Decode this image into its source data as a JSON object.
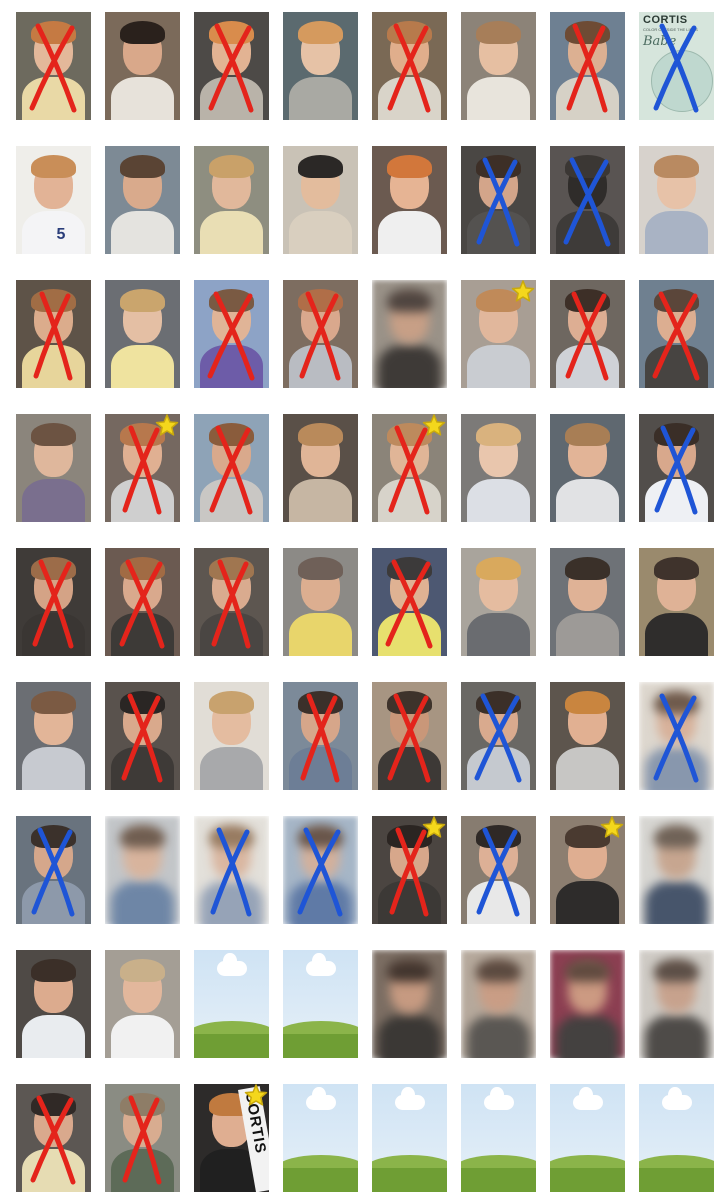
{
  "colors": {
    "x_red": "#e4241b",
    "x_blue": "#1f55d6",
    "star_yellow": "#f4d71c",
    "star_outline": "#c9a90d",
    "sky": "#d8e8f6",
    "grass": "#7ea843"
  },
  "marks_legend": [
    "red-x",
    "blue-x",
    "star",
    "none"
  ],
  "texts": {
    "cover_title": "CORTIS",
    "cover_sub": "COLOR OUTSIDE THE LINES",
    "cover_script": "Babe",
    "shirt_number": "5",
    "banner_text": "CORTIS"
  },
  "rows": [
    [
      {
        "kind": "photo",
        "mark": "red-x",
        "bg": "#6d6a5e",
        "skin": "#e3b89a",
        "hair": "#c57a43",
        "shirt": "#e9d9a6"
      },
      {
        "kind": "photo",
        "mark": "none",
        "bg": "#7b6a5a",
        "skin": "#d9a88a",
        "hair": "#2a211c",
        "shirt": "#e7e2da"
      },
      {
        "kind": "photo",
        "mark": "red-x",
        "bg": "#4d4a47",
        "skin": "#e2b393",
        "hair": "#d98c4c",
        "shirt": "#b9b3a9"
      },
      {
        "kind": "photo",
        "mark": "none",
        "bg": "#5b6a6f",
        "skin": "#e6c2a6",
        "hair": "#d59a5e",
        "shirt": "#a9a9a3"
      },
      {
        "kind": "photo",
        "mark": "red-x",
        "bg": "#7a6955",
        "skin": "#e0ae8c",
        "hair": "#b77a4c",
        "shirt": "#d9d4c9"
      },
      {
        "kind": "photo",
        "mark": "none",
        "bg": "#8c8378",
        "skin": "#e6bfa2",
        "hair": "#a77e59",
        "shirt": "#e8e4dc"
      },
      {
        "kind": "photo",
        "mark": "red-x",
        "bg": "#6e8092",
        "skin": "#dcb092",
        "hair": "#6e4b34",
        "shirt": "#d6d1c6"
      },
      {
        "kind": "cover",
        "mark": "blue-x",
        "bg": "#d6e5dc"
      }
    ],
    [
      {
        "kind": "shirt5",
        "mark": "none",
        "bg": "#efeeea",
        "skin": "#e2b396",
        "hair": "#c98e58",
        "shirt": "#f4f4f6"
      },
      {
        "kind": "photo",
        "mark": "none",
        "bg": "#7d8a95",
        "skin": "#d9aa8c",
        "hair": "#5a4434",
        "shirt": "#e4e3df"
      },
      {
        "kind": "photo",
        "mark": "none",
        "bg": "#8e8e80",
        "skin": "#e1b89b",
        "hair": "#c9a169",
        "shirt": "#e9deb4"
      },
      {
        "kind": "photo",
        "mark": "none",
        "bg": "#c9c2b6",
        "skin": "#e3bc9d",
        "hair": "#2b2826",
        "shirt": "#d9cfbf"
      },
      {
        "kind": "photo",
        "mark": "none",
        "bg": "#6b5a50",
        "skin": "#e6b494",
        "hair": "#d2773b",
        "shirt": "#efefef"
      },
      {
        "kind": "photo",
        "mark": "blue-x",
        "bg": "#4a4744",
        "skin": "#d3a58a",
        "hair": "#3d2f27",
        "shirt": "#545250"
      },
      {
        "kind": "photo",
        "mark": "blue-x",
        "bg": "#595452",
        "skin": "#2f2c2a",
        "hair": "#3b3734",
        "shirt": "#3e3b39"
      },
      {
        "kind": "photo",
        "mark": "none",
        "bg": "#d7d2cc",
        "skin": "#e7c2a8",
        "hair": "#b98a61",
        "shirt": "#a9b3c4"
      }
    ],
    [
      {
        "kind": "photo",
        "mark": "red-x",
        "bg": "#5e5348",
        "skin": "#dbac8c",
        "hair": "#a16d45",
        "shirt": "#e7d59b"
      },
      {
        "kind": "photo",
        "mark": "none",
        "bg": "#6b6e73",
        "skin": "#e4bfa4",
        "hair": "#caa56d",
        "shirt": "#efe39f"
      },
      {
        "kind": "photo",
        "mark": "red-x",
        "bg": "#8da3c6",
        "skin": "#e0b497",
        "hair": "#7a5a43",
        "shirt": "#6d5ca8"
      },
      {
        "kind": "photo",
        "mark": "red-x",
        "bg": "#7d6d60",
        "skin": "#d9a88d",
        "hair": "#b06e48",
        "shirt": "#b9bcc2"
      },
      {
        "kind": "photo",
        "mark": "none",
        "blur": true,
        "bg": "#9a9288",
        "skin": "#c79f86",
        "hair": "#4f4540",
        "shirt": "#3e3a37"
      },
      {
        "kind": "photo",
        "mark": "star",
        "bg": "#a89e94",
        "skin": "#e1b79c",
        "hair": "#c08a59",
        "shirt": "#c9ccd1"
      },
      {
        "kind": "photo",
        "mark": "red-x",
        "bg": "#6e6760",
        "skin": "#ddae93",
        "hair": "#3d2f27",
        "shirt": "#cfd2d7"
      },
      {
        "kind": "photo",
        "mark": "red-x",
        "bg": "#6f8090",
        "skin": "#dcae91",
        "hair": "#5b463a",
        "shirt": "#474441"
      }
    ],
    [
      {
        "kind": "photo",
        "mark": "none",
        "bg": "#8b857c",
        "skin": "#dfb79c",
        "hair": "#6c5342",
        "shirt": "#7a6f8e"
      },
      {
        "kind": "photo",
        "mark": "red-x-star",
        "bg": "#756860",
        "skin": "#e0b092",
        "hair": "#b7784d",
        "shirt": "#cfcfcf"
      },
      {
        "kind": "photo",
        "mark": "red-x",
        "bg": "#8ea3b7",
        "skin": "#d9a98c",
        "hair": "#8a5c3c",
        "shirt": "#c9c7c4"
      },
      {
        "kind": "photo",
        "mark": "none",
        "bg": "#5a5048",
        "skin": "#e0b597",
        "hair": "#b98a5b",
        "shirt": "#c6b6a3"
      },
      {
        "kind": "photo",
        "mark": "red-x-star",
        "bg": "#8b8479",
        "skin": "#e0b597",
        "hair": "#bd8a5d",
        "shirt": "#d7d3ca"
      },
      {
        "kind": "photo",
        "mark": "none",
        "bg": "#7c7a78",
        "skin": "#e9c6ad",
        "hair": "#d9b27e",
        "shirt": "#dcdfe5"
      },
      {
        "kind": "photo",
        "mark": "none",
        "bg": "#5f6870",
        "skin": "#e2b497",
        "hair": "#a87e55",
        "shirt": "#e1e2e4"
      },
      {
        "kind": "photo",
        "mark": "blue-x",
        "bg": "#524e4b",
        "skin": "#d8a88c",
        "hair": "#3a2e27",
        "shirt": "#eef0f4"
      }
    ],
    [
      {
        "kind": "photo",
        "mark": "red-x",
        "bg": "#3f3b38",
        "skin": "#d4a386",
        "hair": "#9c6c49",
        "shirt": "#3a3633"
      },
      {
        "kind": "photo",
        "mark": "red-x",
        "bg": "#6b5a51",
        "skin": "#d9a98d",
        "hair": "#a16b44",
        "shirt": "#3d3a37"
      },
      {
        "kind": "photo",
        "mark": "red-x",
        "bg": "#5d5650",
        "skin": "#d9ab8f",
        "hair": "#a07650",
        "shirt": "#4a4643"
      },
      {
        "kind": "photo",
        "mark": "none",
        "bg": "#8c8a86",
        "skin": "#dcae90",
        "hair": "#6f6058",
        "shirt": "#e8d56b"
      },
      {
        "kind": "photo",
        "mark": "red-x",
        "bg": "#4d5872",
        "skin": "#dfb293",
        "hair": "#3c3a3a",
        "shirt": "#e7e06e"
      },
      {
        "kind": "photo",
        "mark": "none",
        "bg": "#a9a49c",
        "skin": "#e5bca0",
        "hair": "#d9a95d",
        "shirt": "#6a6c70"
      },
      {
        "kind": "photo",
        "mark": "none",
        "bg": "#6e7277",
        "skin": "#dfb296",
        "hair": "#3a3029",
        "shirt": "#9d9a97"
      },
      {
        "kind": "photo",
        "mark": "none",
        "bg": "#9a8a6d",
        "skin": "#dfb296",
        "hair": "#3f332c",
        "shirt": "#2f2d2c"
      }
    ],
    [
      {
        "kind": "photo",
        "mark": "none",
        "bg": "#6b6e73",
        "skin": "#e2b598",
        "hair": "#7b5a43",
        "shirt": "#c7cad0"
      },
      {
        "kind": "photo",
        "mark": "red-x",
        "bg": "#59524d",
        "skin": "#d9a98c",
        "hair": "#2a2624",
        "shirt": "#3e3a37"
      },
      {
        "kind": "photo",
        "mark": "none",
        "bg": "#e1ddd6",
        "skin": "#e4bca0",
        "hair": "#c8a26e",
        "shirt": "#a8a9ab"
      },
      {
        "kind": "photo",
        "mark": "red-x",
        "bg": "#7c8a99",
        "skin": "#d6a68a",
        "hair": "#3b302a",
        "shirt": "#6d7e96"
      },
      {
        "kind": "photo",
        "mark": "red-x",
        "bg": "#a79582",
        "skin": "#c99779",
        "hair": "#3e332b",
        "shirt": "#3d3936"
      },
      {
        "kind": "photo",
        "mark": "blue-x",
        "bg": "#6a6864",
        "skin": "#d9aa8e",
        "hair": "#3b2f28",
        "shirt": "#c5c9cf"
      },
      {
        "kind": "photo",
        "mark": "none",
        "bg": "#5d554d",
        "skin": "#e1b092",
        "hair": "#c9853f",
        "shirt": "#c7c6c4"
      },
      {
        "kind": "photo",
        "mark": "blue-x",
        "blur": true,
        "bg": "#ddd7ce",
        "skin": "#d7b19a",
        "hair": "#6e5a4c",
        "shirt": "#8897ad"
      }
    ],
    [
      {
        "kind": "photo",
        "mark": "blue-x",
        "bg": "#69737e",
        "skin": "#d5a78b",
        "hair": "#3b312b",
        "shirt": "#8d99aa"
      },
      {
        "kind": "photo",
        "mark": "none",
        "blur": true,
        "bg": "#c3c6c9",
        "skin": "#d8b49d",
        "hair": "#6f5d50",
        "shirt": "#6e86a6"
      },
      {
        "kind": "photo",
        "mark": "blue-x",
        "blur": true,
        "bg": "#e3e0da",
        "skin": "#d9b6a0",
        "hair": "#977b61",
        "shirt": "#96a3b7"
      },
      {
        "kind": "photo",
        "mark": "blue-x",
        "blur": true,
        "bg": "#a6b6c7",
        "skin": "#d3b09b",
        "hair": "#68554a",
        "shirt": "#5f7aa6"
      },
      {
        "kind": "photo",
        "mark": "red-x-star",
        "bg": "#4b4541",
        "skin": "#d7a78b",
        "hair": "#2b2522",
        "shirt": "#3c3936"
      },
      {
        "kind": "photo",
        "mark": "blue-x",
        "bg": "#877c70",
        "skin": "#ddb096",
        "hair": "#2f2926",
        "shirt": "#e8e8e8"
      },
      {
        "kind": "photo",
        "mark": "star",
        "bg": "#8c7e70",
        "skin": "#dfae91",
        "hair": "#4a3a30",
        "shirt": "#2e2c2b"
      },
      {
        "kind": "photo",
        "mark": "none",
        "blur": true,
        "bg": "#d7d6d2",
        "skin": "#c7a690",
        "hair": "#6f6257",
        "shirt": "#47556b"
      }
    ],
    [
      {
        "kind": "photo",
        "mark": "none",
        "bg": "#4f4a46",
        "skin": "#dcab8e",
        "hair": "#3b2f28",
        "shirt": "#e9ecef"
      },
      {
        "kind": "photo",
        "mark": "none",
        "bg": "#a49e95",
        "skin": "#e2b79c",
        "hair": "#c9b08a",
        "shirt": "#f1f1f1"
      },
      {
        "kind": "placeholder",
        "mark": "none"
      },
      {
        "kind": "placeholder",
        "mark": "none"
      },
      {
        "kind": "photo",
        "mark": "none",
        "blur": true,
        "bg": "#7c6e63",
        "skin": "#c69a81",
        "hair": "#43362f",
        "shirt": "#3b3835"
      },
      {
        "kind": "photo",
        "mark": "none",
        "blur": true,
        "bg": "#b6a99c",
        "skin": "#c99d85",
        "hair": "#5b4a40",
        "shirt": "#5a5753"
      },
      {
        "kind": "photo",
        "mark": "none",
        "blur": true,
        "bg": "#8c3f52",
        "skin": "#cc9a82",
        "hair": "#614b40",
        "shirt": "#444140"
      },
      {
        "kind": "photo",
        "mark": "none",
        "blur": true,
        "bg": "#cfcbc5",
        "skin": "#c7a28d",
        "hair": "#5c4f47",
        "shirt": "#4e4b48"
      }
    ],
    [
      {
        "kind": "photo",
        "mark": "red-x",
        "bg": "#5c5753",
        "skin": "#d9a98d",
        "hair": "#302926",
        "shirt": "#e6dcb3"
      },
      {
        "kind": "photo",
        "mark": "red-x",
        "bg": "#8a8c83",
        "skin": "#d8ac90",
        "hair": "#8e7d67",
        "shirt": "#5d6b58"
      },
      {
        "kind": "banner",
        "mark": "star",
        "bg": "#2d2b2a",
        "skin": "#dfae91",
        "hair": "#c07a3f",
        "shirt": "#202020"
      },
      {
        "kind": "placeholder",
        "mark": "none"
      },
      {
        "kind": "placeholder",
        "mark": "none"
      },
      {
        "kind": "placeholder",
        "mark": "none"
      },
      {
        "kind": "placeholder",
        "mark": "none"
      },
      {
        "kind": "placeholder",
        "mark": "none"
      }
    ]
  ]
}
